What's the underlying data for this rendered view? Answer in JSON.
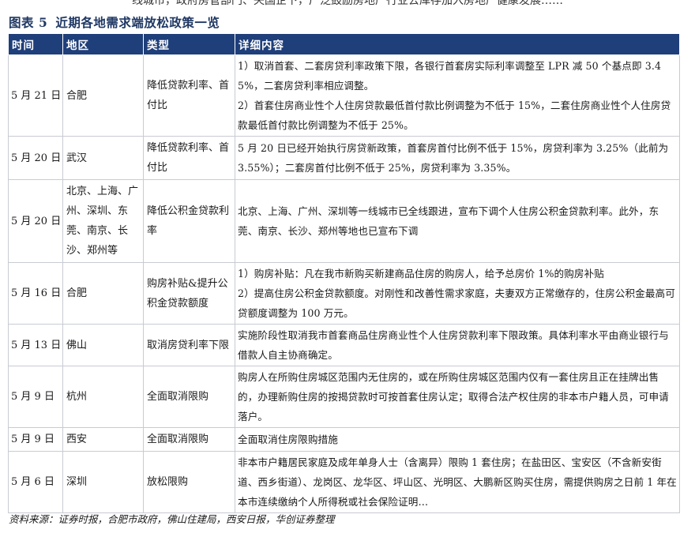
{
  "top_fragment": "线城市，政府房管部门、央国企下，广泛鼓励房地产行业去库存加入房地产健康发展……",
  "figure": {
    "label": "图表",
    "number": "5",
    "title": "近期各地需求端放松政策一览"
  },
  "table": {
    "headers": {
      "date": "时间",
      "region": "地区",
      "type": "类型",
      "detail": "详细内容"
    },
    "rows": [
      {
        "date": "5 月 21 日",
        "region": "合肥",
        "type": "降低贷款利率、首付比",
        "detail": [
          "1）取消首套、二套房贷利率政策下限，各银行首套房实际利率调整至 LPR 减 50 个基点即 3.45%，二套房贷利率相应调整。",
          "2）首套住房商业性个人住房贷款最低首付款比例调整为不低于 15%，二套住房商业性个人住房贷款最低首付款比例调整为不低于 25%。"
        ]
      },
      {
        "date": "5 月 20 日",
        "region": "武汉",
        "type": "降低贷款利率、首付比",
        "detail": [
          "5 月 20 日已经开始执行房贷新政策，首套房首付比例不低于 15%，房贷利率为 3.25%（此前为 3.55%）；二套房首付比例不低于 25%，房贷利率为 3.35%。"
        ]
      },
      {
        "date": "5 月 20 日",
        "region": "北京、上海、广州、深圳、东莞、南京、长沙、郑州等",
        "type": "降低公积金贷款利率",
        "detail": [
          "北京、上海、广州、深圳等一线城市已全线跟进，宣布下调个人住房公积金贷款利率。此外，东莞、南京、长沙、郑州等地也已宣布下调"
        ]
      },
      {
        "date": "5 月 16 日",
        "region": "合肥",
        "type": "购房补贴&提升公积金贷款额度",
        "detail": [
          "1）购房补贴：凡在我市新购买新建商品住房的购房人，给予总房价 1%的购房补贴",
          "2）提高住房公积金贷款额度。对刚性和改善性需求家庭，夫妻双方正常缴存的，住房公积金最高可贷额度调整为 100 万元。"
        ]
      },
      {
        "date": "5 月 13 日",
        "region": "佛山",
        "type": "取消房贷利率下限",
        "detail": [
          "实施阶段性取消我市首套商品住房商业性个人住房贷款利率下限政策。具体利率水平由商业银行与借款人自主协商确定。"
        ]
      },
      {
        "date": "5 月 9 日",
        "region": "杭州",
        "type": "全面取消限购",
        "detail": [
          "购房人在所购住房城区范围内无住房的，或在所购住房城区范围内仅有一套住房且正在挂牌出售的，办理新购住房的按揭贷款时可按首套住房认定；取得合法产权住房的非本市户籍人员，可申请落户。"
        ]
      },
      {
        "date": "5 月 9 日",
        "region": "西安",
        "type": "全面取消限购",
        "detail": [
          "全面取消住房限购措施"
        ]
      },
      {
        "date": "5 月 6 日",
        "region": "深圳",
        "type": "放松限购",
        "detail": [
          "非本市户籍居民家庭及成年单身人士（含离异）限购 1 套住房；在盐田区、宝安区（不含新安街道、西乡街道）、龙岗区、龙华区、坪山区、光明区、大鹏新区购买住房，需提供购房之日前 1 年在本市连续缴纳个人所得税或社会保险证明…"
        ]
      }
    ]
  },
  "source": "资料来源：证券时报，合肥市政府，佛山住建局，西安日报，华创证券整理",
  "colors": {
    "header_bg": "#1f3f7a",
    "title_color": "#1f3864",
    "border": "#c7cbd2"
  }
}
